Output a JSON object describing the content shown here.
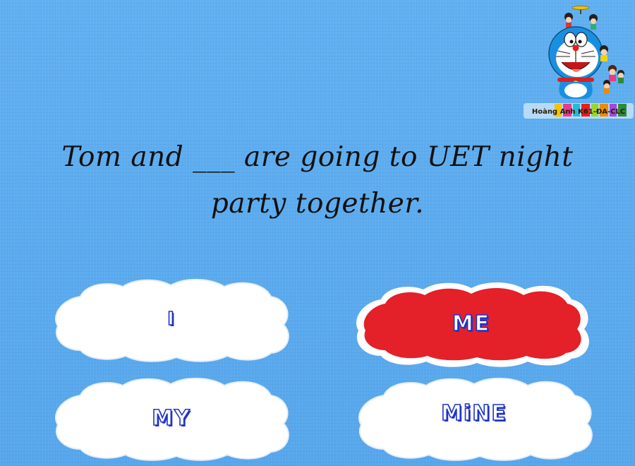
{
  "question": {
    "line1": "Tom and ___ are going to UET night",
    "line2": "party together."
  },
  "answers": [
    {
      "label": "I",
      "state": "default"
    },
    {
      "label": "ME",
      "state": "selected"
    },
    {
      "label": "MY",
      "state": "default"
    },
    {
      "label": "MiNE",
      "state": "default"
    }
  ],
  "logo": {
    "caption": "Hoàng Anh K61-ĐA-CLC",
    "icon": "doraemon-logo-icon"
  },
  "colors": {
    "background": "#5aaaee",
    "cloud": "#ffffff",
    "cloud_selected": "#e42028",
    "label_outline": "#1f35c9",
    "question_text": "#111111"
  }
}
